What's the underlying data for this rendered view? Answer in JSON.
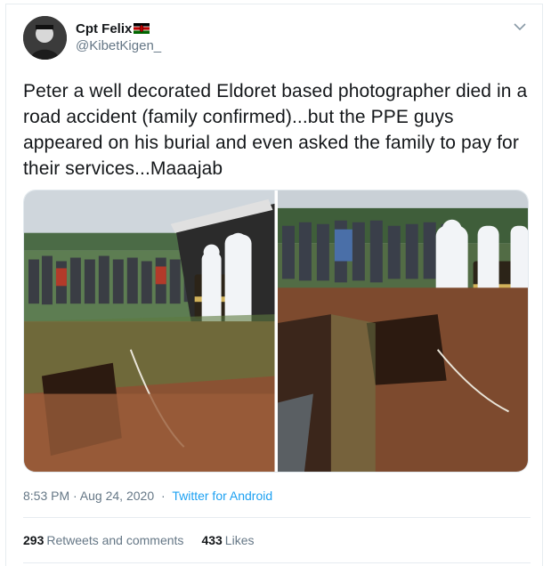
{
  "author": {
    "display_name": "Cpt Felix",
    "handle": "@KibetKigen_",
    "avatar_icon": "avatar-portrait",
    "flag_icon": "kenya-flag-icon"
  },
  "tweet": {
    "text": "Peter a well decorated Eldoret based photographer died in a road accident (family confirmed)...but the PPE guys appeared on his burial and even asked the family to pay for their services...Maaajab",
    "timestamp": "8:53 PM · Aug 24, 2020",
    "separator": "·",
    "source": "Twitter for Android"
  },
  "stats": {
    "retweets_count": "293",
    "retweets_label": "Retweets and comments",
    "likes_count": "433",
    "likes_label": "Likes"
  },
  "colors": {
    "link": "#1da1f2",
    "secondary_text": "#657786",
    "primary_text": "#14171a"
  }
}
